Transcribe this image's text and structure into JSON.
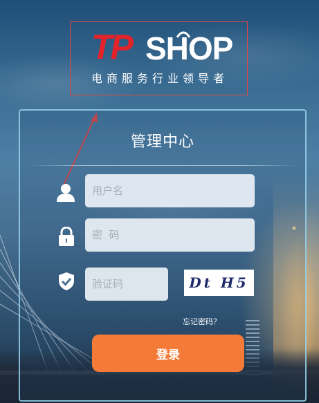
{
  "logo": {
    "brand_tp": "TP",
    "brand_shop": "SHOP",
    "slogan": "电商服务行业领导者"
  },
  "panel": {
    "title": "管理中心"
  },
  "form": {
    "username": {
      "value": "",
      "placeholder": "用户名"
    },
    "password": {
      "value": "",
      "placeholder": "密  码"
    },
    "captcha": {
      "value": "",
      "placeholder": "验证码"
    },
    "captcha_image_text": "Dt H5",
    "forgot_password": "忘记密码？",
    "login_button": "登录"
  },
  "colors": {
    "accent_button": "#f47a37",
    "logo_red": "#e2232a",
    "annotation_red": "#e04646",
    "panel_border": "#96d2eb"
  },
  "icons": {
    "username": "user-icon",
    "password": "lock-icon",
    "captcha": "shield-check-icon"
  }
}
